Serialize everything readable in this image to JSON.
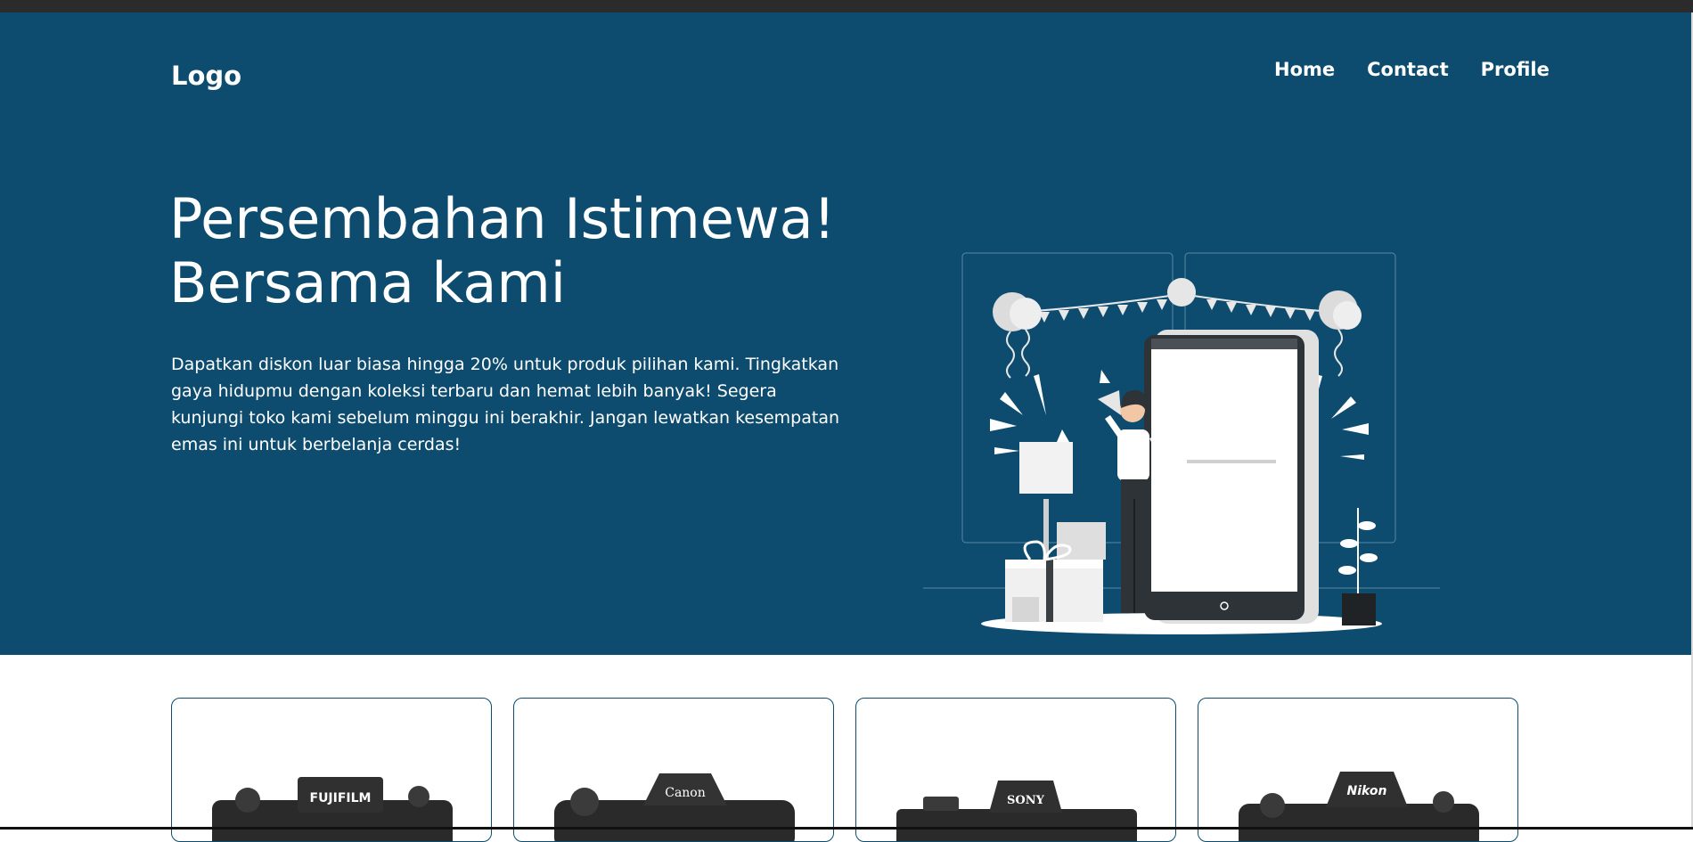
{
  "header": {
    "logo": "Logo",
    "nav": [
      "Home",
      "Contact",
      "Profile"
    ]
  },
  "hero": {
    "title_line1": "Persembahan Istimewa!",
    "title_line2": "Bersama kami",
    "description": "Dapatkan diskon luar biasa hingga 20% untuk produk pilihan kami. Tingkatkan gaya hidupmu dengan koleksi terbaru dan hemat lebih banyak! Segera kunjungi toko kami sebelum minggu ini berakhir. Jangan lewatkan kesempatan emas ini untuk berbelanja cerdas!"
  },
  "products": [
    {
      "brand": "FUJIFILM"
    },
    {
      "brand": "Canon"
    },
    {
      "brand": "SONY"
    },
    {
      "brand": "Nikon"
    }
  ],
  "colors": {
    "hero_bg": "#0e4c6f",
    "white": "#ffffff",
    "card_border": "#0e4c6f"
  }
}
